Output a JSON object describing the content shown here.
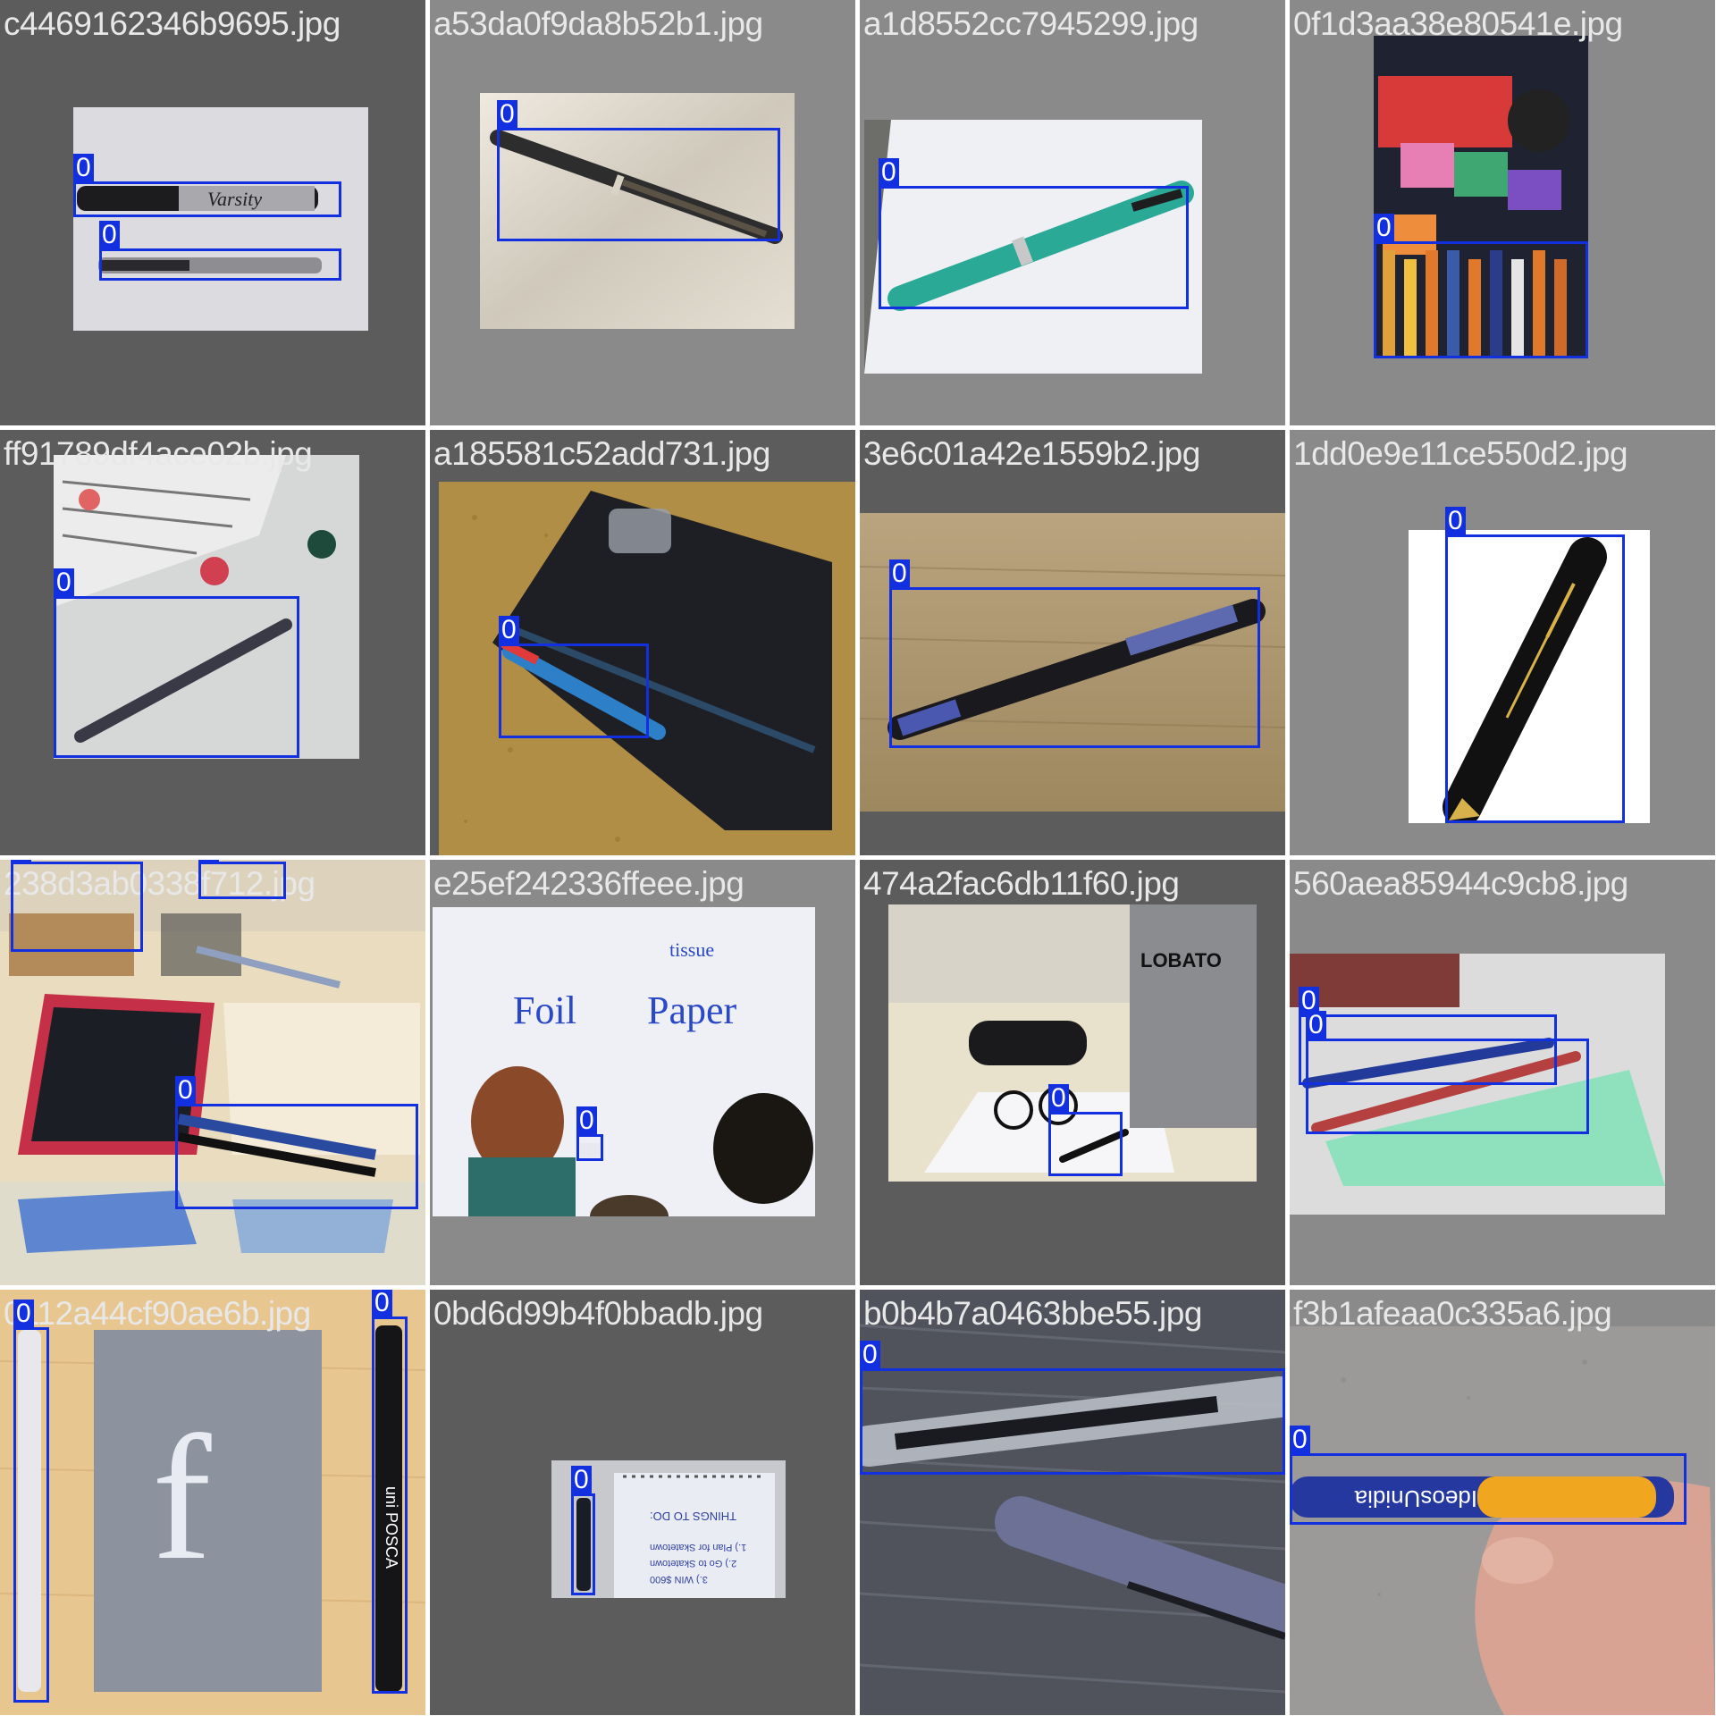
{
  "colors": {
    "box": "#1230e0"
  },
  "tiles": [
    {
      "filename": "c4469162346b9695.jpg",
      "labels": [
        "0",
        "0"
      ]
    },
    {
      "filename": "a53da0f9da8b52b1.jpg",
      "labels": [
        "0"
      ]
    },
    {
      "filename": "a1d8552cc7945299.jpg",
      "labels": [
        "0"
      ]
    },
    {
      "filename": "0f1d3aa38e80541e.jpg",
      "labels": [
        "0"
      ]
    },
    {
      "filename": "ff91789df4ace02b.jpg",
      "labels": [
        "0"
      ]
    },
    {
      "filename": "a185581c52add731.jpg",
      "labels": [
        "0"
      ]
    },
    {
      "filename": "3e6c01a42e1559b2.jpg",
      "labels": [
        "0"
      ]
    },
    {
      "filename": "1dd0e9e11ce550d2.jpg",
      "labels": [
        "0"
      ]
    },
    {
      "filename": "238d3ab0338f712.jpg",
      "labels": [
        "0",
        "0",
        "0"
      ]
    },
    {
      "filename": "e25ef242336ffeee.jpg",
      "labels": [
        "0"
      ]
    },
    {
      "filename": "474a2fac6db11f60.jpg",
      "labels": [
        "0"
      ]
    },
    {
      "filename": "560aea85944c9cb8.jpg",
      "labels": [
        "0",
        "0"
      ]
    },
    {
      "filename": "0112a44cf90ae6b.jpg",
      "labels": [
        "0",
        "0"
      ]
    },
    {
      "filename": "0bd6d99b4f0bbadb.jpg",
      "labels": [
        "0"
      ]
    },
    {
      "filename": "b0b4b7a0463bbe55.jpg",
      "labels": [
        "0"
      ]
    },
    {
      "filename": "f3b1afeaa0c335a6.jpg",
      "labels": [
        "0"
      ]
    }
  ],
  "photo_text": {
    "varsity": "Varsity",
    "foil": "Foil",
    "paper": "Paper",
    "tissue": "tissue",
    "lobato": "LOBATO",
    "posca": "uni POSCA",
    "todo_title": "THINGS TO DO:",
    "todo_1": "1.) Plan for Skatetown",
    "todo_2": "2.) Go to Skatetown",
    "todo_3": "3.) WIN $600",
    "ideos": "IdeosUnidia"
  }
}
